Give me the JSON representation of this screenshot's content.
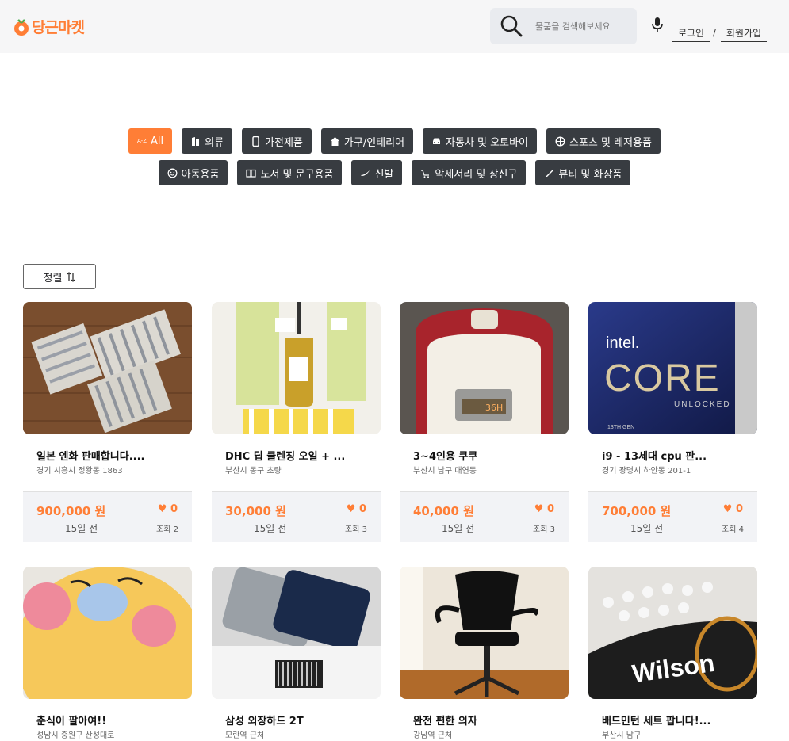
{
  "header": {
    "logo_text": "당근마켓",
    "search_placeholder": "물품을 검색해보세요",
    "login": "로그인",
    "slash": "/",
    "signup": "회원가입"
  },
  "categories_row1": [
    {
      "label": "All",
      "icon": "az-icon",
      "active": true
    },
    {
      "label": "의류",
      "icon": "clothes-icon"
    },
    {
      "label": "가전제품",
      "icon": "phone-icon"
    },
    {
      "label": "가구/인테리어",
      "icon": "home-icon"
    },
    {
      "label": "자동차 및 오토바이",
      "icon": "car-icon"
    },
    {
      "label": "스포츠 및 레저용품",
      "icon": "ball-icon"
    }
  ],
  "categories_row2": [
    {
      "label": "아동용품",
      "icon": "baby-icon"
    },
    {
      "label": "도서 및 문구용품",
      "icon": "book-icon"
    },
    {
      "label": "신발",
      "icon": "shoe-icon"
    },
    {
      "label": "악세서리 및 장신구",
      "icon": "ring-icon"
    },
    {
      "label": "뷰티 및 화장품",
      "icon": "brush-icon"
    }
  ],
  "sort": {
    "label": "정렬"
  },
  "products": [
    {
      "title": "일본 엔화 판매합니다....",
      "location": "경기 시흥시 정왕동 1863",
      "price": "900,000 원",
      "likes": "0",
      "time": "15일 전",
      "views": "조회 2"
    },
    {
      "title": "DHC 딥 클렌징 오일 + ...",
      "location": "부산시 동구 초량",
      "price": "30,000 원",
      "likes": "0",
      "time": "15일 전",
      "views": "조회 3"
    },
    {
      "title": "3~4인용 쿠쿠",
      "location": "부산시 남구 대연동",
      "price": "40,000 원",
      "likes": "0",
      "time": "15일 전",
      "views": "조회 3"
    },
    {
      "title": "i9 - 13세대 cpu 판...",
      "location": "경기 광명시 하안동 201-1",
      "price": "700,000 원",
      "likes": "0",
      "time": "15일 전",
      "views": "조회 4"
    },
    {
      "title": "춘식이 팔아여!!",
      "location": "성남시 중원구 산성대로"
    },
    {
      "title": "삼성 외장하드 2T",
      "location": "모란역 근처"
    },
    {
      "title": "완전 편한 의자",
      "location": "강남역 근처"
    },
    {
      "title": "배드민턴 세트 팝니다!...",
      "location": "부산시 남구"
    }
  ],
  "image_text": {
    "intel": "intel.",
    "core": "CORE",
    "unlocked": "UNLOCKED",
    "gen": "13TH GEN",
    "rice_display": "36H",
    "brand_wilson": "Wilson"
  },
  "colors": {
    "accent": "#ff7e36",
    "chip": "#383c41",
    "header_bg": "#f6f6f7"
  }
}
